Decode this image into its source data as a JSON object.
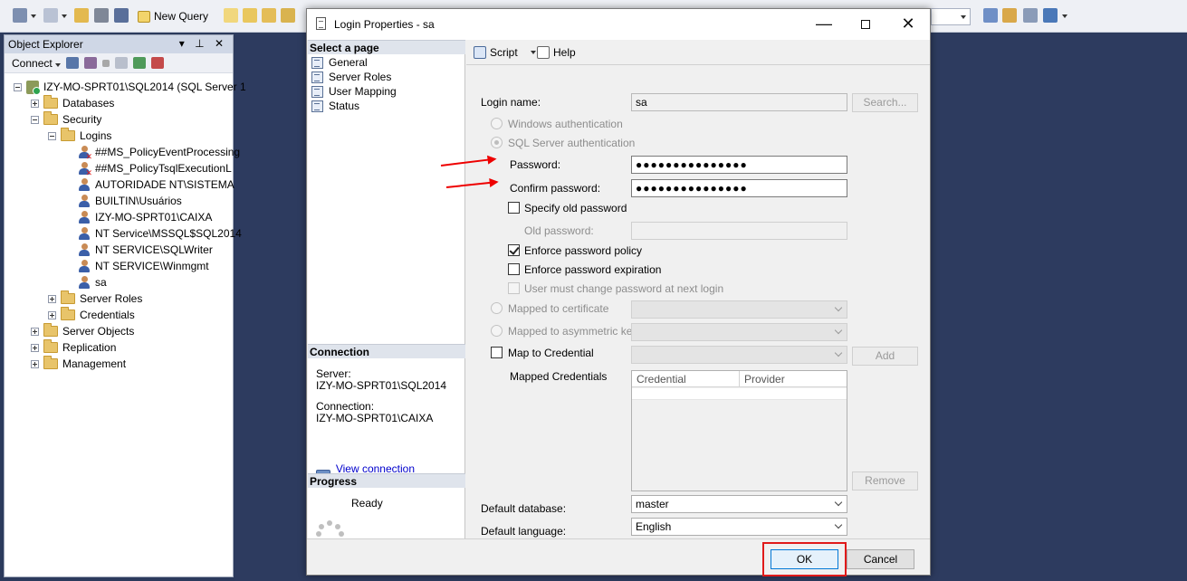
{
  "toolbar": {
    "new_query_label": "New Query"
  },
  "object_explorer": {
    "title": "Object Explorer",
    "title_controls": "▾ ⊥ ✕",
    "connect_label": "Connect",
    "tree": [
      {
        "label": "IZY-MO-SPRT01\\SQL2014 (SQL Server 1",
        "kind": "server",
        "level": 0,
        "expander": "minus"
      },
      {
        "label": "Databases",
        "kind": "folder",
        "level": 1,
        "expander": "plus"
      },
      {
        "label": "Security",
        "kind": "folder",
        "level": 1,
        "expander": "minus"
      },
      {
        "label": "Logins",
        "kind": "folder",
        "level": 2,
        "expander": "minus"
      },
      {
        "label": "##MS_PolicyEventProcessing",
        "kind": "user-disabled",
        "level": 3
      },
      {
        "label": "##MS_PolicyTsqlExecutionL",
        "kind": "user-disabled",
        "level": 3
      },
      {
        "label": "AUTORIDADE NT\\SISTEMA",
        "kind": "user",
        "level": 3
      },
      {
        "label": "BUILTIN\\Usuários",
        "kind": "group",
        "level": 3
      },
      {
        "label": "IZY-MO-SPRT01\\CAIXA",
        "kind": "user",
        "level": 3
      },
      {
        "label": "NT Service\\MSSQL$SQL2014",
        "kind": "user",
        "level": 3
      },
      {
        "label": "NT SERVICE\\SQLWriter",
        "kind": "user",
        "level": 3
      },
      {
        "label": "NT SERVICE\\Winmgmt",
        "kind": "user",
        "level": 3
      },
      {
        "label": "sa",
        "kind": "user",
        "level": 3
      },
      {
        "label": "Server Roles",
        "kind": "folder",
        "level": 2,
        "expander": "plus"
      },
      {
        "label": "Credentials",
        "kind": "folder",
        "level": 2,
        "expander": "plus"
      },
      {
        "label": "Server Objects",
        "kind": "folder",
        "level": 1,
        "expander": "plus"
      },
      {
        "label": "Replication",
        "kind": "folder",
        "level": 1,
        "expander": "plus"
      },
      {
        "label": "Management",
        "kind": "folder",
        "level": 1,
        "expander": "plus"
      }
    ]
  },
  "dialog": {
    "title": "Login Properties - sa",
    "window_buttons": {
      "minimize": "—",
      "close": "✕"
    },
    "select_page_header": "Select a page",
    "pages": [
      "General",
      "Server Roles",
      "User Mapping",
      "Status"
    ],
    "connection_header": "Connection",
    "server_label": "Server:",
    "server_value": "IZY-MO-SPRT01\\SQL2014",
    "connection_label": "Connection:",
    "connection_value": "IZY-MO-SPRT01\\CAIXA",
    "view_connection_link": "View connection properties",
    "progress_header": "Progress",
    "progress_status": "Ready",
    "script_label": "Script",
    "help_label": "Help",
    "form": {
      "login_name_label": "Login name:",
      "login_name_value": "sa",
      "search_button": "Search...",
      "windows_auth_label": "Windows authentication",
      "sql_auth_label": "SQL Server authentication",
      "password_label": "Password:",
      "password_value": "●●●●●●●●●●●●●●●",
      "confirm_password_label": "Confirm password:",
      "confirm_password_value": "●●●●●●●●●●●●●●●",
      "specify_old_password_label": "Specify old password",
      "old_password_label": "Old password:",
      "enforce_policy_label": "Enforce password policy",
      "enforce_policy_checked": true,
      "enforce_expiration_label": "Enforce password expiration",
      "enforce_expiration_checked": false,
      "must_change_label": "User must change password at next login",
      "mapped_certificate_label": "Mapped to certificate",
      "mapped_asym_key_label": "Mapped to asymmetric key",
      "map_credential_label": "Map to Credential",
      "add_button": "Add",
      "mapped_credentials_label": "Mapped Credentials",
      "grid_columns": [
        "Credential",
        "Provider"
      ],
      "remove_button": "Remove",
      "default_database_label": "Default database:",
      "default_database_value": "master",
      "default_language_label": "Default language:",
      "default_language_value": "English"
    },
    "ok_button": "OK",
    "cancel_button": "Cancel"
  },
  "colors": {
    "workspace": "#2d3b5f",
    "highlight_red": "#e01a1a",
    "link_blue": "#0000cc"
  }
}
